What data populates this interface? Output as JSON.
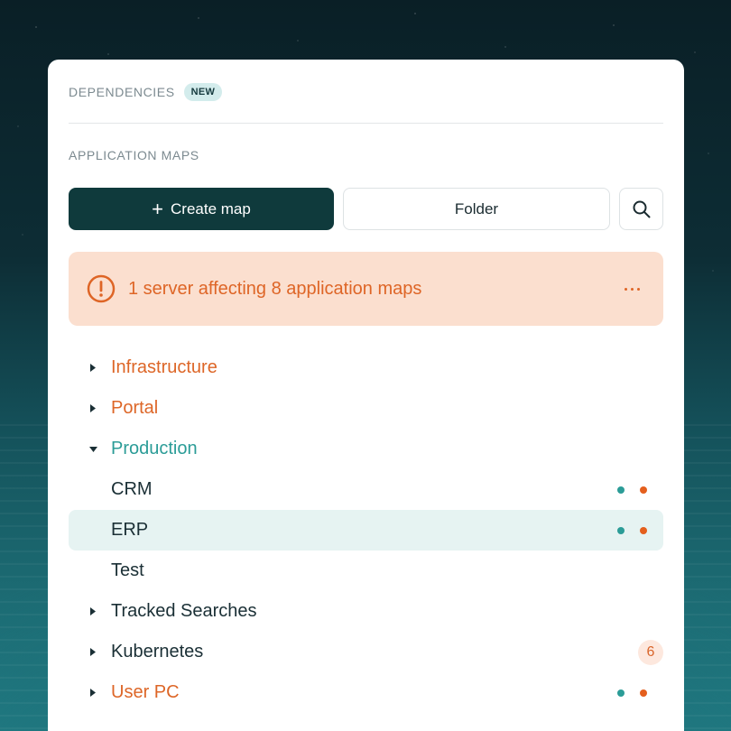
{
  "panel": {
    "section_title": "DEPENDENCIES",
    "badge": "NEW",
    "subsection_title": "APPLICATION MAPS"
  },
  "toolbar": {
    "create_label": "Create map",
    "folder_label": "Folder",
    "search_icon": "search-icon"
  },
  "alert": {
    "text": "1 server affecting 8 application maps",
    "icon": "exclamation-circle-icon",
    "more_icon": "more-horizontal-icon"
  },
  "colors": {
    "primary": "#0f3a3c",
    "warning": "#de6526",
    "warning_bg": "#fbdfcf",
    "teal": "#2b9c97",
    "selected_bg": "#e6f3f2"
  },
  "tree": {
    "items": [
      {
        "label": "Infrastructure"
      },
      {
        "label": "Portal"
      },
      {
        "label": "Production"
      },
      {
        "label": "CRM"
      },
      {
        "label": "ERP"
      },
      {
        "label": "Test"
      },
      {
        "label": "Tracked Searches"
      },
      {
        "label": "Kubernetes",
        "count": "6"
      },
      {
        "label": "User PC"
      }
    ]
  }
}
